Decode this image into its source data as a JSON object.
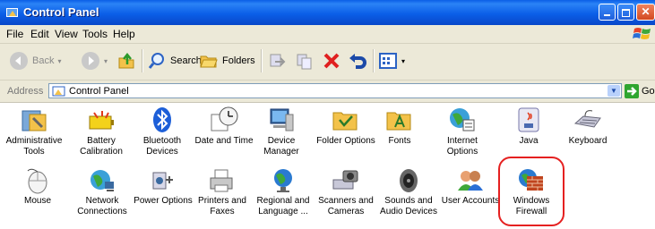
{
  "window": {
    "title": "Control Panel"
  },
  "menu": [
    "File",
    "Edit",
    "View",
    "Tools",
    "Help"
  ],
  "toolbar": {
    "back": "Back",
    "search": "Search",
    "folders": "Folders"
  },
  "address": {
    "label": "Address",
    "value": "Control Panel",
    "go": "Go"
  },
  "items": [
    {
      "label": "Administrative\nTools",
      "icon": "administrative-tools-icon"
    },
    {
      "label": "Battery\nCalibration",
      "icon": "battery-calibration-icon"
    },
    {
      "label": "Bluetooth\nDevices",
      "icon": "bluetooth-icon"
    },
    {
      "label": "Date and Time",
      "icon": "date-time-icon"
    },
    {
      "label": "Device\nManager",
      "icon": "device-manager-icon"
    },
    {
      "label": "Folder Options",
      "icon": "folder-options-icon"
    },
    {
      "label": "Fonts",
      "icon": "fonts-icon"
    },
    {
      "label": "Internet\nOptions",
      "icon": "internet-options-icon"
    },
    {
      "label": "Java",
      "icon": "java-icon"
    },
    {
      "label": "Keyboard",
      "icon": "keyboard-icon"
    },
    {
      "label": "Mouse",
      "icon": "mouse-icon"
    },
    {
      "label": "Network\nConnections",
      "icon": "network-connections-icon"
    },
    {
      "label": "Power Options",
      "icon": "power-options-icon"
    },
    {
      "label": "Printers and\nFaxes",
      "icon": "printers-faxes-icon"
    },
    {
      "label": "Regional and\nLanguage ...",
      "icon": "regional-language-icon"
    },
    {
      "label": "Scanners and\nCameras",
      "icon": "scanners-cameras-icon"
    },
    {
      "label": "Sounds and\nAudio Devices",
      "icon": "sounds-audio-icon"
    },
    {
      "label": "User Accounts",
      "icon": "user-accounts-icon"
    },
    {
      "label": "Windows\nFirewall",
      "icon": "windows-firewall-icon"
    }
  ],
  "colors": {
    "title_bar": "#0b5fe8",
    "highlight": "#e52020",
    "chrome": "#ece9d8"
  }
}
